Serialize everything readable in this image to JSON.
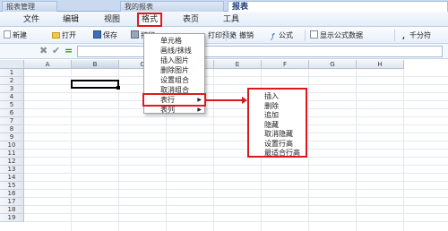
{
  "tabs": [
    {
      "label": "报表管理",
      "active": false
    },
    {
      "label": "我的报表",
      "active": false
    },
    {
      "label": "报表",
      "active": true
    }
  ],
  "menubar": {
    "items": [
      "文件",
      "编辑",
      "视图",
      "格式",
      "表页",
      "工具"
    ],
    "highlighted": "格式"
  },
  "toolbar": {
    "new_label": "新建",
    "open_label": "打开",
    "save_label": "保存",
    "print_label": "打印",
    "print_preview_label": "打印预览",
    "undo_label": "撤销",
    "formula_label": "公式",
    "show_formula_label": "显示公式数据",
    "thousands_label": "千分符"
  },
  "formula_bar": {
    "cancel_icon": "✖",
    "confirm_icon": "✔",
    "equals_icon": "="
  },
  "grid": {
    "columns": [
      "A",
      "B",
      "C",
      "D",
      "E",
      "F",
      "G",
      "H"
    ],
    "rows": [
      "1",
      "2",
      "3",
      "4",
      "5",
      "6",
      "7",
      "8",
      "9",
      "10",
      "11",
      "12",
      "13",
      "14",
      "15",
      "16",
      "17",
      "18",
      "19"
    ],
    "selected_cell": "B2"
  },
  "format_menu": {
    "items": [
      {
        "label": "单元格",
        "has_submenu": false
      },
      {
        "label": "画线/抹线",
        "has_submenu": false
      },
      {
        "label": "插入图片",
        "has_submenu": false
      },
      {
        "label": "删除图片",
        "has_submenu": false
      },
      {
        "label": "设置组合",
        "has_submenu": false
      },
      {
        "label": "取消组合",
        "has_submenu": false
      },
      {
        "label": "表行",
        "has_submenu": true,
        "highlighted": true
      },
      {
        "label": "表列",
        "has_submenu": true
      }
    ],
    "submenu_arrow": "▶"
  },
  "row_submenu": {
    "items": [
      "插入",
      "删除",
      "追加",
      "隐藏",
      "取消隐藏",
      "设置行高",
      "最适合行高"
    ]
  },
  "colors": {
    "highlight_red": "#e0191e",
    "tab_bar": "#c9daf0",
    "active_tab_text": "#1a3d7c"
  }
}
